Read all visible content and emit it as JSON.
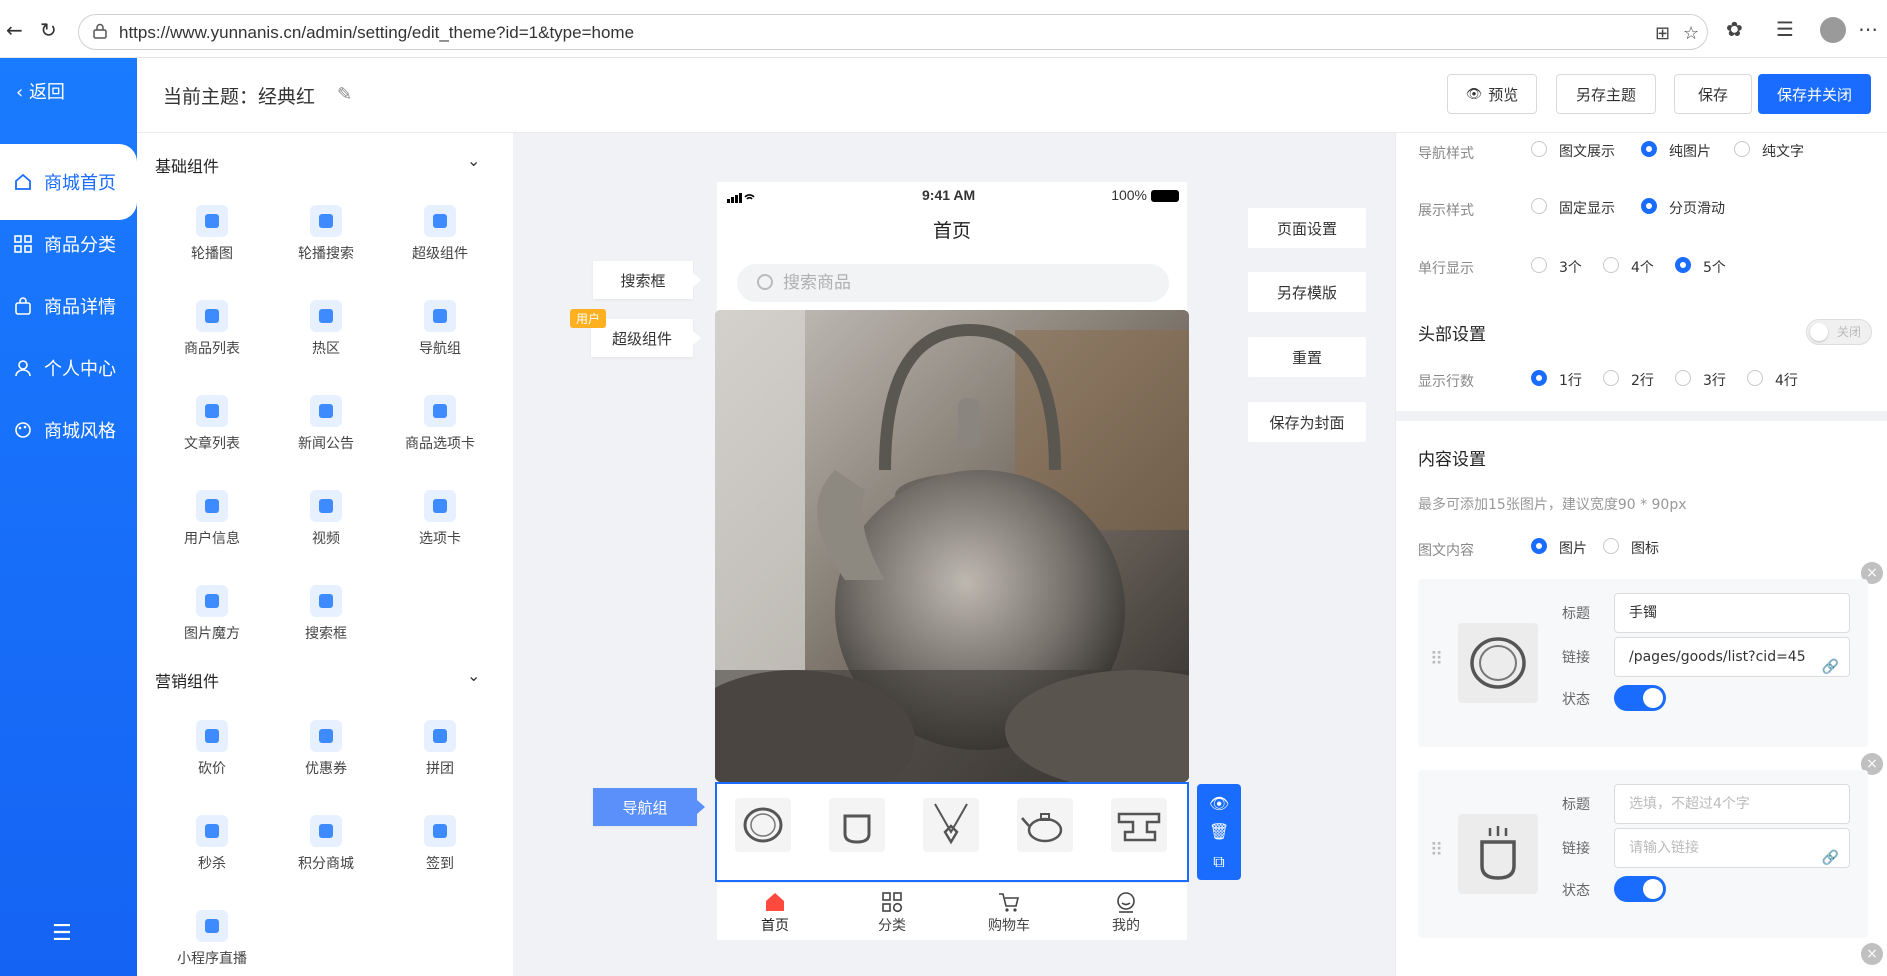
{
  "browser": {
    "url": "https://www.yunnanis.cn/admin/setting/edit_theme?id=1&type=home"
  },
  "sidebar": {
    "back_label": "返回",
    "items": [
      {
        "label": "商城首页",
        "icon": "home-icon",
        "active": true
      },
      {
        "label": "商品分类",
        "icon": "grid-icon",
        "active": false
      },
      {
        "label": "商品详情",
        "icon": "bag-icon",
        "active": false
      },
      {
        "label": "个人中心",
        "icon": "user-icon",
        "active": false
      },
      {
        "label": "商城风格",
        "icon": "palette-icon",
        "active": false
      }
    ]
  },
  "header": {
    "theme_title": "当前主题：经典红",
    "preview_label": "预览",
    "save_as_theme_label": "另存主题",
    "save_label": "保存",
    "save_close_label": "保存并关闭"
  },
  "components": {
    "basic_title": "基础组件",
    "basic": [
      "轮播图",
      "轮播搜索",
      "超级组件",
      "商品列表",
      "热区",
      "导航组",
      "文章列表",
      "新闻公告",
      "商品选项卡",
      "用户信息",
      "视频",
      "选项卡",
      "图片魔方",
      "搜索框"
    ],
    "marketing_title": "营销组件",
    "marketing": [
      "砍价",
      "优惠券",
      "拼团",
      "秒杀",
      "积分商城",
      "签到",
      "小程序直播"
    ]
  },
  "phone": {
    "time": "9:41 AM",
    "battery": "100%",
    "title": "首页",
    "search_placeholder": "搜索商品",
    "tabs": [
      "首页",
      "分类",
      "购物车",
      "我的"
    ]
  },
  "canvas": {
    "label_search": "搜索框",
    "label_super": "超级组件",
    "user_tag": "用户",
    "label_nav": "导航组",
    "page_settings": "页面设置",
    "save_template": "另存模版",
    "reset": "重置",
    "save_cover": "保存为封面"
  },
  "settings": {
    "nav_style_label": "导航样式",
    "nav_style_options": [
      "图文展示",
      "纯图片",
      "纯文字"
    ],
    "nav_style_selected": 1,
    "display_style_label": "展示样式",
    "display_style_options": [
      "固定显示",
      "分页滑动"
    ],
    "display_style_selected": 1,
    "single_row_label": "单行显示",
    "single_row_options": [
      "3个",
      "4个",
      "5个"
    ],
    "single_row_selected": 2,
    "header_title": "头部设置",
    "header_toggle": "关闭",
    "rows_label": "显示行数",
    "rows_options": [
      "1行",
      "2行",
      "3行",
      "4行"
    ],
    "rows_selected": 0,
    "content_title": "内容设置",
    "content_hint": "最多可添加15张图片，建议宽度90 * 90px",
    "content_type_label": "图文内容",
    "content_type_options": [
      "图片",
      "图标"
    ],
    "content_type_selected": 0,
    "items": [
      {
        "title_label": "标题",
        "title_value": "手镯",
        "link_label": "链接",
        "link_value": "/pages/goods/list?cid=45",
        "status_label": "状态"
      },
      {
        "title_label": "标题",
        "title_placeholder": "选填，不超过4个字",
        "link_label": "链接",
        "link_placeholder": "请输入链接",
        "status_label": "状态"
      }
    ]
  }
}
